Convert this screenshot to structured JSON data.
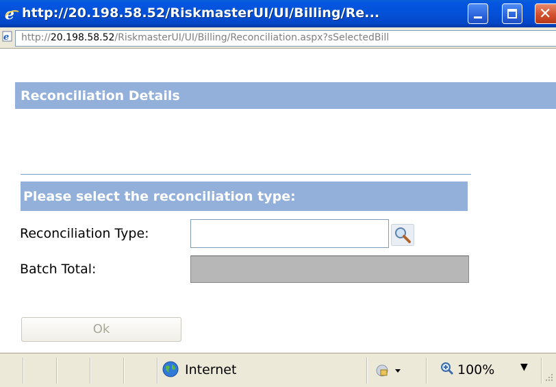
{
  "window": {
    "title": "http://20.198.58.52/RiskmasterUI/UI/Billing/Re...",
    "close_glyph": "✕"
  },
  "address": {
    "prefix": "http://",
    "host": "20.198.58.52",
    "path": "/RiskmasterUI/UI/Billing/Reconciliation.aspx?sSelectedBill"
  },
  "page": {
    "section_title": "Reconciliation Details",
    "subheader": "Please select the reconciliation type:",
    "reconciliation_type_label": "Reconciliation Type:",
    "reconciliation_type_value": "",
    "batch_total_label": "Batch Total:",
    "batch_total_value": "",
    "ok_label": "Ok"
  },
  "statusbar": {
    "zone": "Internet",
    "zoom": "100%",
    "zoom_dropdown": "▼"
  },
  "colors": {
    "title_bar": "#0454dc",
    "header_band": "#92b0d9",
    "chrome": "#ece9d8",
    "disabled_field": "#b7b7b7"
  }
}
